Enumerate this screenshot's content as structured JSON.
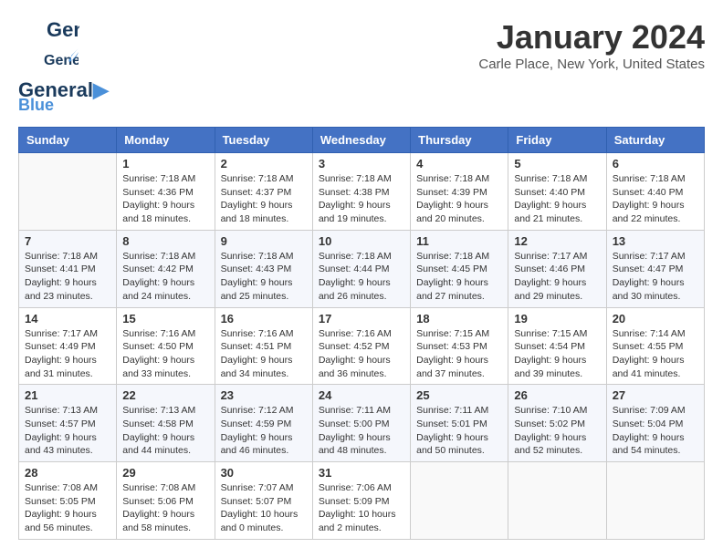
{
  "header": {
    "logo_general": "General",
    "logo_blue": "Blue",
    "month_title": "January 2024",
    "location": "Carle Place, New York, United States"
  },
  "weekdays": [
    "Sunday",
    "Monday",
    "Tuesday",
    "Wednesday",
    "Thursday",
    "Friday",
    "Saturday"
  ],
  "weeks": [
    [
      {
        "day": "",
        "sunrise": "",
        "sunset": "",
        "daylight": ""
      },
      {
        "day": "1",
        "sunrise": "Sunrise: 7:18 AM",
        "sunset": "Sunset: 4:36 PM",
        "daylight": "Daylight: 9 hours and 18 minutes."
      },
      {
        "day": "2",
        "sunrise": "Sunrise: 7:18 AM",
        "sunset": "Sunset: 4:37 PM",
        "daylight": "Daylight: 9 hours and 18 minutes."
      },
      {
        "day": "3",
        "sunrise": "Sunrise: 7:18 AM",
        "sunset": "Sunset: 4:38 PM",
        "daylight": "Daylight: 9 hours and 19 minutes."
      },
      {
        "day": "4",
        "sunrise": "Sunrise: 7:18 AM",
        "sunset": "Sunset: 4:39 PM",
        "daylight": "Daylight: 9 hours and 20 minutes."
      },
      {
        "day": "5",
        "sunrise": "Sunrise: 7:18 AM",
        "sunset": "Sunset: 4:40 PM",
        "daylight": "Daylight: 9 hours and 21 minutes."
      },
      {
        "day": "6",
        "sunrise": "Sunrise: 7:18 AM",
        "sunset": "Sunset: 4:40 PM",
        "daylight": "Daylight: 9 hours and 22 minutes."
      }
    ],
    [
      {
        "day": "7",
        "sunrise": "Sunrise: 7:18 AM",
        "sunset": "Sunset: 4:41 PM",
        "daylight": "Daylight: 9 hours and 23 minutes."
      },
      {
        "day": "8",
        "sunrise": "Sunrise: 7:18 AM",
        "sunset": "Sunset: 4:42 PM",
        "daylight": "Daylight: 9 hours and 24 minutes."
      },
      {
        "day": "9",
        "sunrise": "Sunrise: 7:18 AM",
        "sunset": "Sunset: 4:43 PM",
        "daylight": "Daylight: 9 hours and 25 minutes."
      },
      {
        "day": "10",
        "sunrise": "Sunrise: 7:18 AM",
        "sunset": "Sunset: 4:44 PM",
        "daylight": "Daylight: 9 hours and 26 minutes."
      },
      {
        "day": "11",
        "sunrise": "Sunrise: 7:18 AM",
        "sunset": "Sunset: 4:45 PM",
        "daylight": "Daylight: 9 hours and 27 minutes."
      },
      {
        "day": "12",
        "sunrise": "Sunrise: 7:17 AM",
        "sunset": "Sunset: 4:46 PM",
        "daylight": "Daylight: 9 hours and 29 minutes."
      },
      {
        "day": "13",
        "sunrise": "Sunrise: 7:17 AM",
        "sunset": "Sunset: 4:47 PM",
        "daylight": "Daylight: 9 hours and 30 minutes."
      }
    ],
    [
      {
        "day": "14",
        "sunrise": "Sunrise: 7:17 AM",
        "sunset": "Sunset: 4:49 PM",
        "daylight": "Daylight: 9 hours and 31 minutes."
      },
      {
        "day": "15",
        "sunrise": "Sunrise: 7:16 AM",
        "sunset": "Sunset: 4:50 PM",
        "daylight": "Daylight: 9 hours and 33 minutes."
      },
      {
        "day": "16",
        "sunrise": "Sunrise: 7:16 AM",
        "sunset": "Sunset: 4:51 PM",
        "daylight": "Daylight: 9 hours and 34 minutes."
      },
      {
        "day": "17",
        "sunrise": "Sunrise: 7:16 AM",
        "sunset": "Sunset: 4:52 PM",
        "daylight": "Daylight: 9 hours and 36 minutes."
      },
      {
        "day": "18",
        "sunrise": "Sunrise: 7:15 AM",
        "sunset": "Sunset: 4:53 PM",
        "daylight": "Daylight: 9 hours and 37 minutes."
      },
      {
        "day": "19",
        "sunrise": "Sunrise: 7:15 AM",
        "sunset": "Sunset: 4:54 PM",
        "daylight": "Daylight: 9 hours and 39 minutes."
      },
      {
        "day": "20",
        "sunrise": "Sunrise: 7:14 AM",
        "sunset": "Sunset: 4:55 PM",
        "daylight": "Daylight: 9 hours and 41 minutes."
      }
    ],
    [
      {
        "day": "21",
        "sunrise": "Sunrise: 7:13 AM",
        "sunset": "Sunset: 4:57 PM",
        "daylight": "Daylight: 9 hours and 43 minutes."
      },
      {
        "day": "22",
        "sunrise": "Sunrise: 7:13 AM",
        "sunset": "Sunset: 4:58 PM",
        "daylight": "Daylight: 9 hours and 44 minutes."
      },
      {
        "day": "23",
        "sunrise": "Sunrise: 7:12 AM",
        "sunset": "Sunset: 4:59 PM",
        "daylight": "Daylight: 9 hours and 46 minutes."
      },
      {
        "day": "24",
        "sunrise": "Sunrise: 7:11 AM",
        "sunset": "Sunset: 5:00 PM",
        "daylight": "Daylight: 9 hours and 48 minutes."
      },
      {
        "day": "25",
        "sunrise": "Sunrise: 7:11 AM",
        "sunset": "Sunset: 5:01 PM",
        "daylight": "Daylight: 9 hours and 50 minutes."
      },
      {
        "day": "26",
        "sunrise": "Sunrise: 7:10 AM",
        "sunset": "Sunset: 5:02 PM",
        "daylight": "Daylight: 9 hours and 52 minutes."
      },
      {
        "day": "27",
        "sunrise": "Sunrise: 7:09 AM",
        "sunset": "Sunset: 5:04 PM",
        "daylight": "Daylight: 9 hours and 54 minutes."
      }
    ],
    [
      {
        "day": "28",
        "sunrise": "Sunrise: 7:08 AM",
        "sunset": "Sunset: 5:05 PM",
        "daylight": "Daylight: 9 hours and 56 minutes."
      },
      {
        "day": "29",
        "sunrise": "Sunrise: 7:08 AM",
        "sunset": "Sunset: 5:06 PM",
        "daylight": "Daylight: 9 hours and 58 minutes."
      },
      {
        "day": "30",
        "sunrise": "Sunrise: 7:07 AM",
        "sunset": "Sunset: 5:07 PM",
        "daylight": "Daylight: 10 hours and 0 minutes."
      },
      {
        "day": "31",
        "sunrise": "Sunrise: 7:06 AM",
        "sunset": "Sunset: 5:09 PM",
        "daylight": "Daylight: 10 hours and 2 minutes."
      },
      {
        "day": "",
        "sunrise": "",
        "sunset": "",
        "daylight": ""
      },
      {
        "day": "",
        "sunrise": "",
        "sunset": "",
        "daylight": ""
      },
      {
        "day": "",
        "sunrise": "",
        "sunset": "",
        "daylight": ""
      }
    ]
  ]
}
